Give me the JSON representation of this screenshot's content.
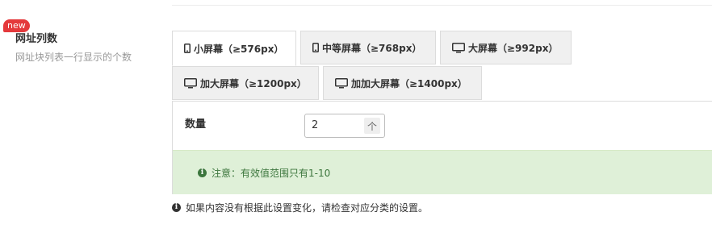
{
  "badge": "new",
  "field": {
    "title": "网址列数",
    "description": "网址块列表一行显示的个数"
  },
  "tabs": [
    {
      "label": "小屏幕（≥576px）",
      "icon": "mobile-icon",
      "active": true
    },
    {
      "label": "中等屏幕（≥768px）",
      "icon": "tablet-icon",
      "active": false
    },
    {
      "label": "大屏幕（≥992px）",
      "icon": "desktop-icon",
      "active": false
    },
    {
      "label": "加大屏幕（≥1200px）",
      "icon": "desktop-icon",
      "active": false
    },
    {
      "label": "加加大屏幕（≥1400px）",
      "icon": "desktop-icon",
      "active": false
    }
  ],
  "quantity": {
    "label": "数量",
    "value": "2",
    "stepper": "个"
  },
  "notice": {
    "icon": "info-icon",
    "text": "注意：有效值范围只有1-10"
  },
  "footnote": {
    "icon": "info-icon",
    "text": "如果内容没有根据此设置变化，请检查对应分类的设置。"
  }
}
